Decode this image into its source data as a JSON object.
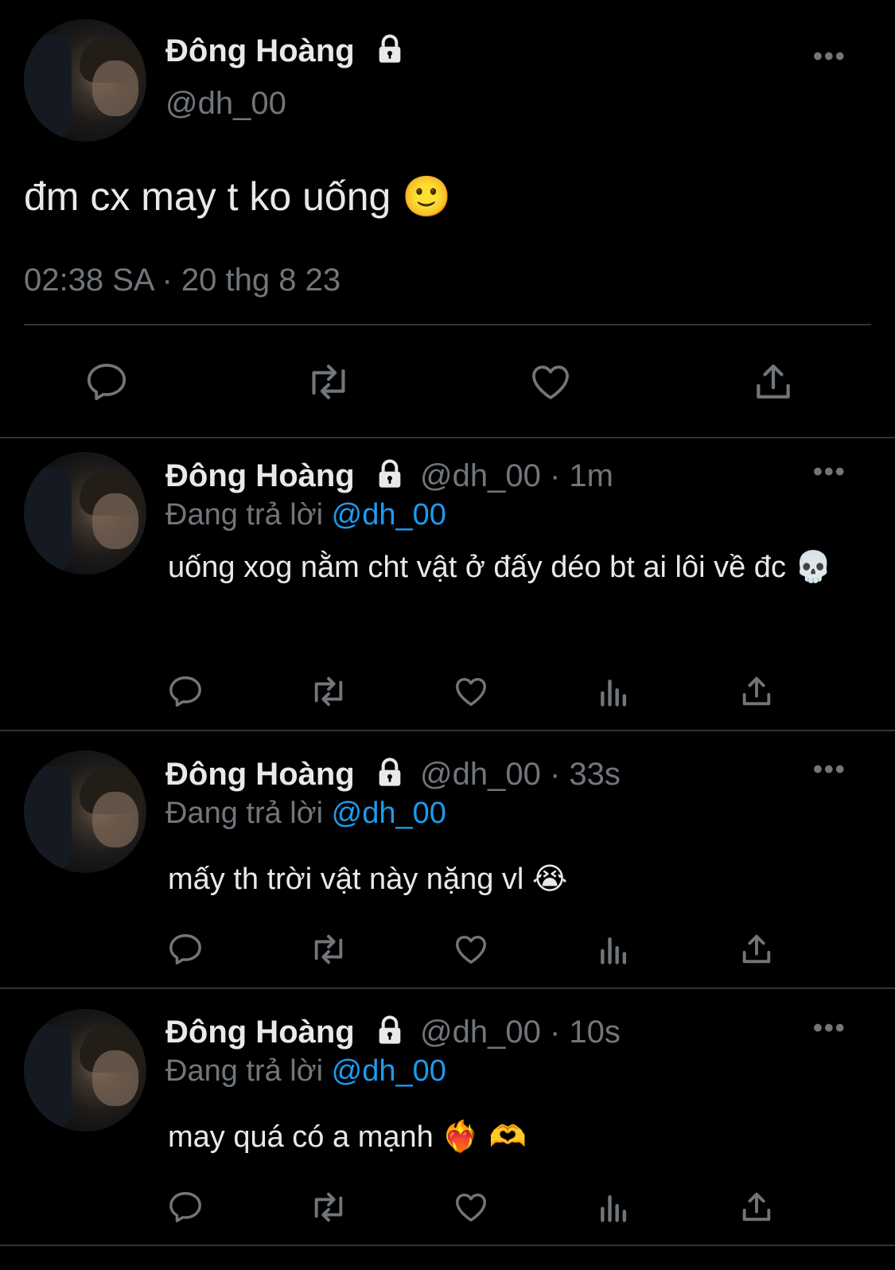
{
  "main_tweet": {
    "display_name": "Đông Hoàng",
    "handle": "@dh_00",
    "text": "đm cx may t ko uống",
    "emoji": "🙂",
    "timestamp": "02:38 SA · 20 thg 8 23",
    "more_label": "•••"
  },
  "replies": [
    {
      "display_name": "Đông Hoàng",
      "meta": "@dh_00 · 1m",
      "replying_label": "Đang trả lời",
      "mention": "@dh_00",
      "text": "uống xog nằm cht vật ở đấy déo bt ai lôi về đc",
      "emoji": "💀",
      "more_label": "•••"
    },
    {
      "display_name": "Đông Hoàng",
      "meta": "@dh_00 · 33s",
      "replying_label": "Đang trả lời",
      "mention": "@dh_00",
      "text": "mấy th trời vật này nặng vl",
      "emoji": "😭",
      "more_label": "•••"
    },
    {
      "display_name": "Đông Hoàng",
      "meta": "@dh_00 · 10s",
      "replying_label": "Đang trả lời",
      "mention": "@dh_00",
      "text": "may quá có a mạnh",
      "emoji": "❤️‍🔥 🫶",
      "more_label": "•••"
    }
  ],
  "icons": {
    "reply": "reply-icon",
    "retweet": "retweet-icon",
    "like": "heart-icon",
    "views": "views-icon",
    "share": "share-icon",
    "lock": "lock-icon"
  },
  "colors": {
    "background": "#000000",
    "text": "#e7e9ea",
    "secondary": "#71767b",
    "mention": "#1d9bf0",
    "divider": "#2f3336"
  }
}
